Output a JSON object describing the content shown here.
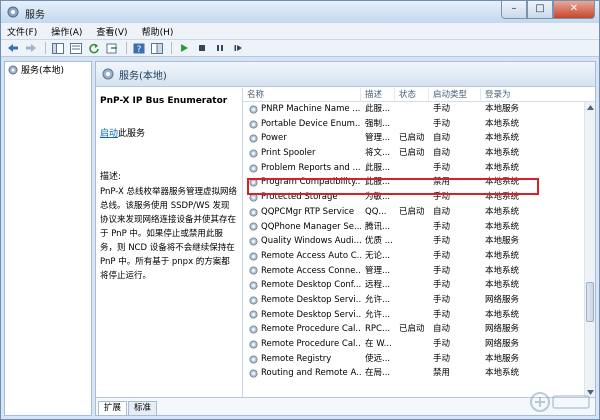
{
  "window": {
    "title": "服务"
  },
  "menu": [
    "文件(F)",
    "操作(A)",
    "查看(V)",
    "帮助(H)"
  ],
  "toolbar": {
    "icons": [
      "back-arrow-icon",
      "forward-arrow-icon",
      "console-tree-icon",
      "properties-icon",
      "refresh-icon",
      "export-icon",
      "help-icon",
      "show-hide-icon",
      "play-icon",
      "stop-icon",
      "pause-icon",
      "restart-icon"
    ]
  },
  "tree": {
    "root_label": "服务(本地)"
  },
  "main": {
    "header": "服务(本地)"
  },
  "details": {
    "service_name": "PnP-X IP Bus Enumerator",
    "start_link": "启动",
    "start_suffix": "此服务",
    "description_label": "描述:",
    "description_text": "PnP-X 总线枚举器服务管理虚拟网络总线。该服务使用 SSDP/WS 发现协议来发现网络连接设备并使其存在于 PnP 中。如果停止或禁用此服务，则 NCD 设备将不会继续保持在 PnP 中。所有基于 pnpx 的方案都将停止运行。"
  },
  "list": {
    "columns": {
      "name": "名称",
      "description": "描述",
      "status": "状态",
      "startup": "启动类型",
      "logon": "登录为"
    },
    "rows": [
      {
        "name": "PNRP Machine Name ...",
        "description": "此服...",
        "status": "",
        "startup": "手动",
        "logon": "本地服务"
      },
      {
        "name": "Portable Device Enum...",
        "description": "强制...",
        "status": "",
        "startup": "手动",
        "logon": "本地系统"
      },
      {
        "name": "Power",
        "description": "管理...",
        "status": "已启动",
        "startup": "自动",
        "logon": "本地系统"
      },
      {
        "name": "Print Spooler",
        "description": "将文...",
        "status": "已启动",
        "startup": "自动",
        "logon": "本地系统"
      },
      {
        "name": "Problem Reports and ...",
        "description": "此服...",
        "status": "",
        "startup": "手动",
        "logon": "本地系统"
      },
      {
        "name": "Program Compatibility...",
        "description": "此服...",
        "status": "",
        "startup": "禁用",
        "logon": "本地系统"
      },
      {
        "name": "Protected Storage",
        "description": "为敏...",
        "status": "",
        "startup": "手动",
        "logon": "本地系统"
      },
      {
        "name": "QQPCMgr RTP Service",
        "description": "QQ...",
        "status": "已启动",
        "startup": "自动",
        "logon": "本地系统"
      },
      {
        "name": "QQPhone Manager Se...",
        "description": "腾讯...",
        "status": "",
        "startup": "手动",
        "logon": "本地系统"
      },
      {
        "name": "Quality Windows Audi...",
        "description": "优质 ...",
        "status": "",
        "startup": "手动",
        "logon": "本地服务"
      },
      {
        "name": "Remote Access Auto C...",
        "description": "无论...",
        "status": "",
        "startup": "手动",
        "logon": "本地系统"
      },
      {
        "name": "Remote Access Conne...",
        "description": "管理...",
        "status": "",
        "startup": "手动",
        "logon": "本地系统"
      },
      {
        "name": "Remote Desktop Conf...",
        "description": "远程...",
        "status": "",
        "startup": "手动",
        "logon": "本地系统"
      },
      {
        "name": "Remote Desktop Servi...",
        "description": "允许...",
        "status": "",
        "startup": "手动",
        "logon": "网络服务"
      },
      {
        "name": "Remote Desktop Servi...",
        "description": "允许...",
        "status": "",
        "startup": "手动",
        "logon": "本地系统"
      },
      {
        "name": "Remote Procedure Cal...",
        "description": "RPC...",
        "status": "已启动",
        "startup": "自动",
        "logon": "网络服务"
      },
      {
        "name": "Remote Procedure Cal...",
        "description": "在 W...",
        "status": "",
        "startup": "手动",
        "logon": "网络服务"
      },
      {
        "name": "Remote Registry",
        "description": "使远...",
        "status": "",
        "startup": "手动",
        "logon": "本地服务"
      },
      {
        "name": "Routing and Remote A...",
        "description": "在局...",
        "status": "",
        "startup": "禁用",
        "logon": "本地系统"
      }
    ]
  },
  "tabs": [
    "扩展",
    "标准"
  ],
  "colors": {
    "highlight": "#d8202a",
    "link": "#0066cc"
  }
}
